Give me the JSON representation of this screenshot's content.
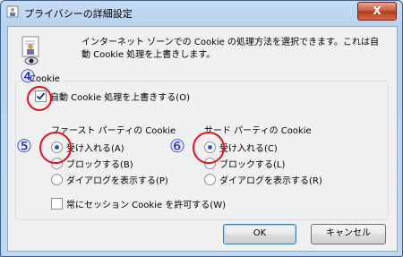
{
  "window": {
    "title": "プライバシーの詳細設定",
    "close_label": "X"
  },
  "description": "インターネット ゾーンでの Cookie の処理方法を選択できます。これは自動 Cookie 処理を上書きします。",
  "group": {
    "legend": "Cookie"
  },
  "override": {
    "label": "自動 Cookie 処理を上書きする(O)",
    "checked": true
  },
  "first_party": {
    "title": "ファースト パーティの Cookie",
    "options": [
      "受け入れる(A)",
      "ブロックする(B)",
      "ダイアログを表示する(P)"
    ],
    "selected": 0
  },
  "third_party": {
    "title": "サード パーティの Cookie",
    "options": [
      "受け入れる(C)",
      "ブロックする(L)",
      "ダイアログを表示する(R)"
    ],
    "selected": 0
  },
  "session": {
    "label": "常にセッション Cookie を許可する(W)",
    "checked": false
  },
  "annotations": {
    "four": "④",
    "five": "⑤",
    "six": "⑥"
  },
  "buttons": {
    "ok": "OK",
    "cancel": "キャンセル"
  }
}
